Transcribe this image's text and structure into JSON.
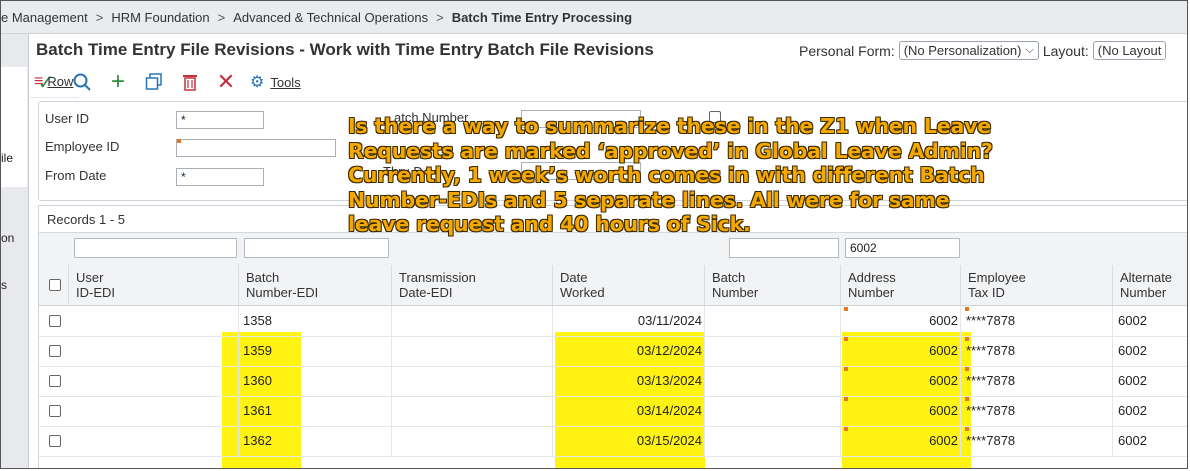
{
  "breadcrumb": {
    "items": [
      "e Management",
      "HRM Foundation",
      "Advanced & Technical Operations",
      "Batch Time Entry Processing"
    ],
    "separator": ">"
  },
  "left_rail": {
    "fragments": [
      "ile",
      "on",
      "s"
    ],
    "collapse_glyph": "«"
  },
  "header": {
    "title": "Batch Time Entry File Revisions - Work with Time Entry Batch File Revisions",
    "personal_form_label": "Personal Form:",
    "personal_form_value": "(No Personalization)",
    "layout_label": "Layout:",
    "layout_value": "(No Layout"
  },
  "toolbar": {
    "row_label": "Row",
    "tools_label": "Tools",
    "icons": [
      "check-icon",
      "search-icon",
      "plus-icon",
      "copy-icon",
      "trash-icon",
      "close-icon",
      "row-icon",
      "gear-icon"
    ]
  },
  "form": {
    "user_id_label": "User ID",
    "user_id_value": "*",
    "employee_id_label": "Employee ID",
    "employee_id_value": "",
    "from_date_label": "From Date",
    "from_date_value": "*",
    "batch_number_label": "atch Number",
    "thru_date_label": "Thru D"
  },
  "grid": {
    "records_label": "Records 1 - 5",
    "filter_address_value": "6002",
    "columns": [
      {
        "line1": "User",
        "line2": "ID-EDI"
      },
      {
        "line1": "Batch",
        "line2": "Number-EDI"
      },
      {
        "line1": "Transmission",
        "line2": "Date-EDI"
      },
      {
        "line1": "Date",
        "line2": "Worked"
      },
      {
        "line1": "Batch",
        "line2": "Number"
      },
      {
        "line1": "Address",
        "line2": "Number"
      },
      {
        "line1": "Employee",
        "line2": "Tax ID"
      },
      {
        "line1": "Alternate",
        "line2": "Number"
      }
    ],
    "rows": [
      {
        "user_id_edi": "",
        "batch_number_edi": "1358",
        "transmission_date_edi": "",
        "date_worked": "03/11/2024",
        "batch_number": "",
        "address_number": "6002",
        "employee_tax_id": "****7878",
        "alternate_number": "6002"
      },
      {
        "user_id_edi": "",
        "batch_number_edi": "1359",
        "transmission_date_edi": "",
        "date_worked": "03/12/2024",
        "batch_number": "",
        "address_number": "6002",
        "employee_tax_id": "****7878",
        "alternate_number": "6002"
      },
      {
        "user_id_edi": "",
        "batch_number_edi": "1360",
        "transmission_date_edi": "",
        "date_worked": "03/13/2024",
        "batch_number": "",
        "address_number": "6002",
        "employee_tax_id": "****7878",
        "alternate_number": "6002"
      },
      {
        "user_id_edi": "",
        "batch_number_edi": "1361",
        "transmission_date_edi": "",
        "date_worked": "03/14/2024",
        "batch_number": "",
        "address_number": "6002",
        "employee_tax_id": "****7878",
        "alternate_number": "6002"
      },
      {
        "user_id_edi": "",
        "batch_number_edi": "1362",
        "transmission_date_edi": "",
        "date_worked": "03/15/2024",
        "batch_number": "",
        "address_number": "6002",
        "employee_tax_id": "****7878",
        "alternate_number": "6002"
      }
    ]
  },
  "annotation": {
    "text": "Is there a way to summarize these in the Z1 when Leave\nRequests are marked ‘approved’ in Global Leave Admin?\nCurrently, 1 week’s worth comes in with different Batch\nNumber-EDIs and 5 separate lines. All were for same\nleave request and 40 hours of Sick.",
    "color": "#f5a800"
  },
  "colors": {
    "highlight": "#fff200",
    "required_marker": "#e87722",
    "accent_green": "#2e8b3d",
    "accent_blue": "#2673b8",
    "accent_red": "#c4313b"
  }
}
